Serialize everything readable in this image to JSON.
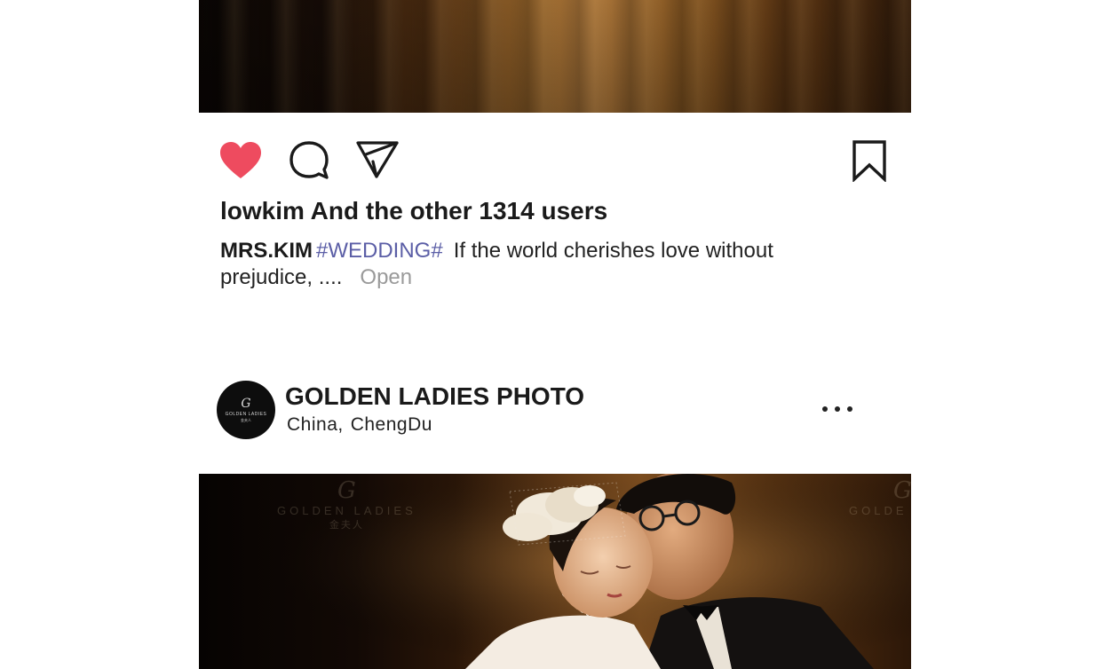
{
  "post_previous": {
    "likes_text": "lowkim And the other 1314 users",
    "caption": {
      "author": "MRS.KIM",
      "hashtag": "#WEDDING#",
      "text": "If the world cherishes love without prejudice, ....",
      "open_label": "Open"
    },
    "actions": {
      "like_icon": "heart-icon",
      "comment_icon": "comment-icon",
      "share_icon": "send-icon",
      "save_icon": "bookmark-icon",
      "liked": true
    }
  },
  "post_next": {
    "account_name": "GOLDEN LADIES PHOTO",
    "location_country": "China,",
    "location_city": "ChengDu",
    "avatar": {
      "monogram": "G",
      "wordmark": "GOLDEN LADIES",
      "wordmark_cn": "金夫人"
    },
    "more_icon": "more-horizontal-icon",
    "photo_watermark": {
      "monogram": "G",
      "wordmark": "GOLDEN LADIES",
      "wordmark_cn": "金夫人",
      "wordmark_partial": "GOLDE"
    }
  },
  "colors": {
    "heart": "#ee4b5f",
    "hashtag": "#5b5ea6",
    "open_link": "#9a9a9a",
    "text": "#1a1a1a"
  }
}
